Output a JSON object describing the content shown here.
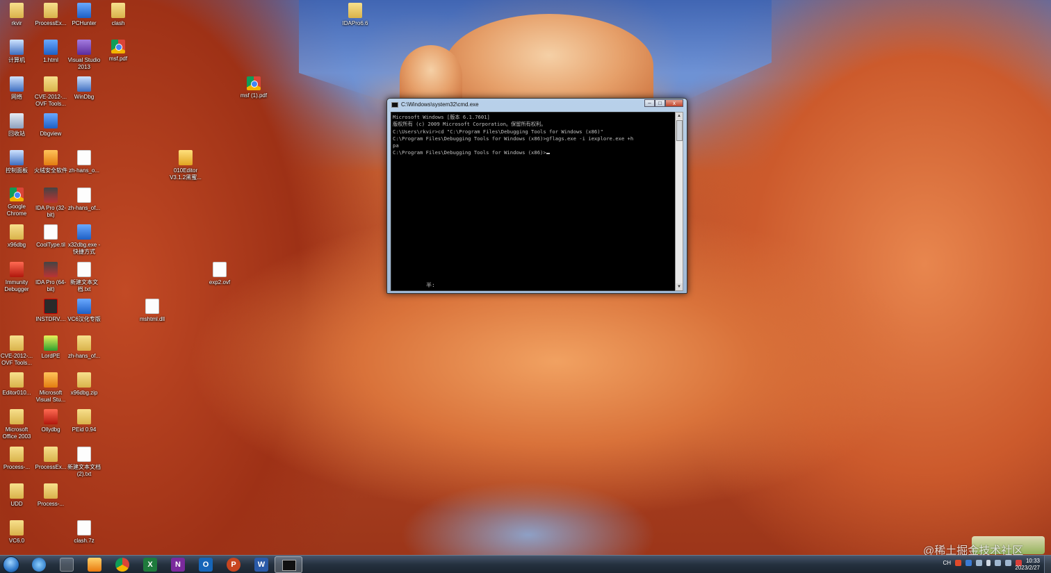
{
  "desktop_icons": [
    {
      "label": "rkvir",
      "icon": "folder-icon"
    },
    {
      "label": "ProcessEx...",
      "icon": "folder-icon"
    },
    {
      "label": "PCHunter",
      "icon": "app-icon"
    },
    {
      "label": "clash",
      "icon": "folder-icon"
    },
    {
      "label": "IDAPro6.6",
      "icon": "folder-icon"
    },
    {
      "label": "计算机",
      "icon": "computer-icon"
    },
    {
      "label": "1.html",
      "icon": "ie-file-icon"
    },
    {
      "label": "Visual Studio 2013",
      "icon": "visual-studio-icon"
    },
    {
      "label": "msf.pdf",
      "icon": "chrome-icon"
    },
    {
      "label": "网络",
      "icon": "network-icon"
    },
    {
      "label": "CVE-2012-... OVF Tools...",
      "icon": "folder-icon"
    },
    {
      "label": "WinDbg",
      "icon": "windbg-icon"
    },
    {
      "label": "msf (1).pdf",
      "icon": "chrome-icon"
    },
    {
      "label": "回收站",
      "icon": "recycle-bin-icon"
    },
    {
      "label": "Dbgview",
      "icon": "dbgview-icon"
    },
    {
      "label": "控制面板",
      "icon": "control-panel-icon"
    },
    {
      "label": "火绒安全软件",
      "icon": "huorong-icon"
    },
    {
      "label": "zh-hans_o...",
      "icon": "file-icon"
    },
    {
      "label": "010Editor V3.1.2黑蜜...",
      "icon": "zip-icon"
    },
    {
      "label": "Google Chrome",
      "icon": "chrome-icon"
    },
    {
      "label": "IDA Pro (32-bit)",
      "icon": "ida-icon"
    },
    {
      "label": "zh-hans_of...",
      "icon": "file-icon"
    },
    {
      "label": "x96dbg",
      "icon": "folder-icon"
    },
    {
      "label": "CoolType.til",
      "icon": "file-icon"
    },
    {
      "label": "x32dbg.exe - 快捷方式",
      "icon": "x32dbg-icon"
    },
    {
      "label": "Immunity Debugger",
      "icon": "immunity-icon"
    },
    {
      "label": "IDA Pro (64-bit)",
      "icon": "ida-icon"
    },
    {
      "label": "新建文本文档.txt",
      "icon": "text-file-icon"
    },
    {
      "label": "exp2.ovf",
      "icon": "file-icon"
    },
    {
      "label": "INSTDRV....",
      "icon": "sys-icon"
    },
    {
      "label": "VC6汉化专版",
      "icon": "vc6-icon"
    },
    {
      "label": "mshtml.dll",
      "icon": "dll-icon"
    },
    {
      "label": "CVE-2012-... OVF Tools...",
      "icon": "folder-icon"
    },
    {
      "label": "LordPE",
      "icon": "lordpe-icon"
    },
    {
      "label": "zh-hans_of...",
      "icon": "folder-icon"
    },
    {
      "label": "Editor010...",
      "icon": "folder-icon"
    },
    {
      "label": "Microsoft Visual Stu...",
      "icon": "msvs-icon"
    },
    {
      "label": "x96dbg.zip",
      "icon": "zip-icon"
    },
    {
      "label": "Microsoft Office 2003",
      "icon": "folder-icon"
    },
    {
      "label": "Ollydbg",
      "icon": "ollydbg-icon"
    },
    {
      "label": "PEid 0.94",
      "icon": "folder-icon"
    },
    {
      "label": "Process-...",
      "icon": "folder-icon"
    },
    {
      "label": "ProcessEx...",
      "icon": "folder-icon"
    },
    {
      "label": "新建文本文档 (2).txt",
      "icon": "text-file-icon"
    },
    {
      "label": "UDD",
      "icon": "folder-icon"
    },
    {
      "label": "Process-...",
      "icon": "folder-icon"
    },
    {
      "label": "VC6.0",
      "icon": "folder-icon"
    },
    {
      "label": "clash.7z",
      "icon": "file-icon"
    }
  ],
  "cmd_window": {
    "title": "C:\\Windows\\system32\\cmd.exe",
    "buttons": {
      "minimize": "–",
      "maximize": "□",
      "close": "x"
    },
    "lines": [
      "Microsoft Windows [版本 6.1.7601]",
      "版权所有 (c) 2009 Microsoft Corporation。保留所有权利。",
      "",
      "C:\\Users\\rkvir>cd \"C:\\Program Files\\Debugging Tools for Windows (x86)\"",
      "",
      "C:\\Program Files\\Debugging Tools for Windows (x86)>gflags.exe -i iexplore.exe +h",
      "pa",
      "",
      "C:\\Program Files\\Debugging Tools for Windows (x86)>"
    ],
    "ime_indicator": "半:"
  },
  "taskbar": {
    "pinned": [
      "start-orb",
      "internet-explorer",
      "windows-explorer",
      "media-player",
      "chrome",
      "excel",
      "onenote",
      "outlook",
      "powerpoint",
      "word",
      "cmd"
    ],
    "tray_text": "CH",
    "clock_time": "10:33",
    "clock_date": "2023/2/27"
  },
  "watermark": "@稀土掘金技术社区"
}
